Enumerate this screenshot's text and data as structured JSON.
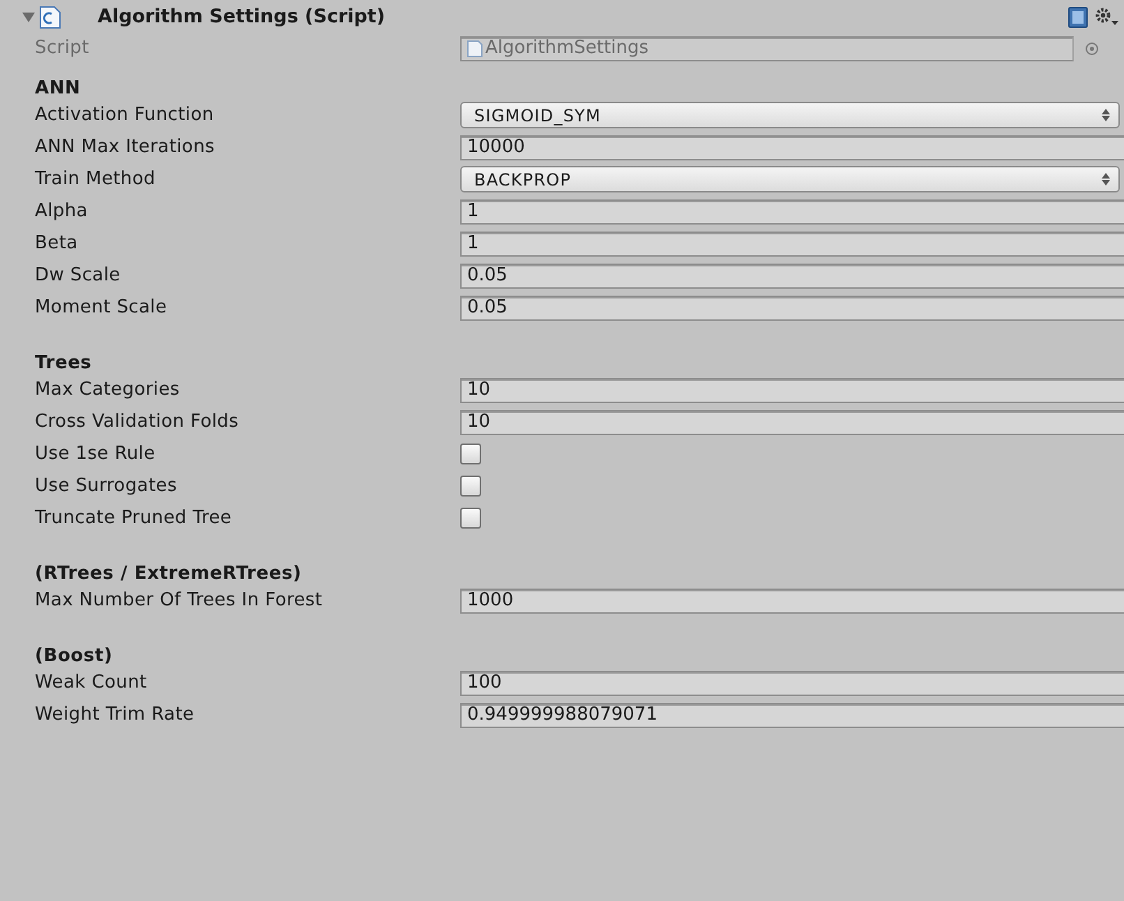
{
  "component": {
    "title": "Algorithm Settings (Script)",
    "expanded": true,
    "script_label": "Script",
    "script_value": "AlgorithmSettings"
  },
  "sections": [
    {
      "title": "ANN",
      "fields": [
        {
          "kind": "dropdown",
          "label": "Activation Function",
          "value": "SIGMOID_SYM"
        },
        {
          "kind": "text",
          "label": "ANN Max Iterations",
          "value": "10000"
        },
        {
          "kind": "dropdown",
          "label": "Train Method",
          "value": "BACKPROP"
        },
        {
          "kind": "text",
          "label": "Alpha",
          "value": "1"
        },
        {
          "kind": "text",
          "label": "Beta",
          "value": "1"
        },
        {
          "kind": "text",
          "label": "Dw Scale",
          "value": "0.05"
        },
        {
          "kind": "text",
          "label": "Moment Scale",
          "value": "0.05"
        }
      ]
    },
    {
      "title": "Trees",
      "fields": [
        {
          "kind": "text",
          "label": "Max Categories",
          "value": "10"
        },
        {
          "kind": "text",
          "label": "Cross Validation Folds",
          "value": "10"
        },
        {
          "kind": "checkbox",
          "label": "Use 1se Rule",
          "checked": false
        },
        {
          "kind": "checkbox",
          "label": "Use Surrogates",
          "checked": false
        },
        {
          "kind": "checkbox",
          "label": "Truncate Pruned Tree",
          "checked": false
        }
      ]
    },
    {
      "title": "(RTrees / ExtremeRTrees)",
      "fields": [
        {
          "kind": "text",
          "label": "Max Number Of Trees In Forest",
          "value": "1000"
        }
      ]
    },
    {
      "title": "(Boost)",
      "fields": [
        {
          "kind": "text",
          "label": "Weak Count",
          "value": "100"
        },
        {
          "kind": "text",
          "label": "Weight Trim Rate",
          "value": "0.949999988079071"
        }
      ]
    }
  ]
}
